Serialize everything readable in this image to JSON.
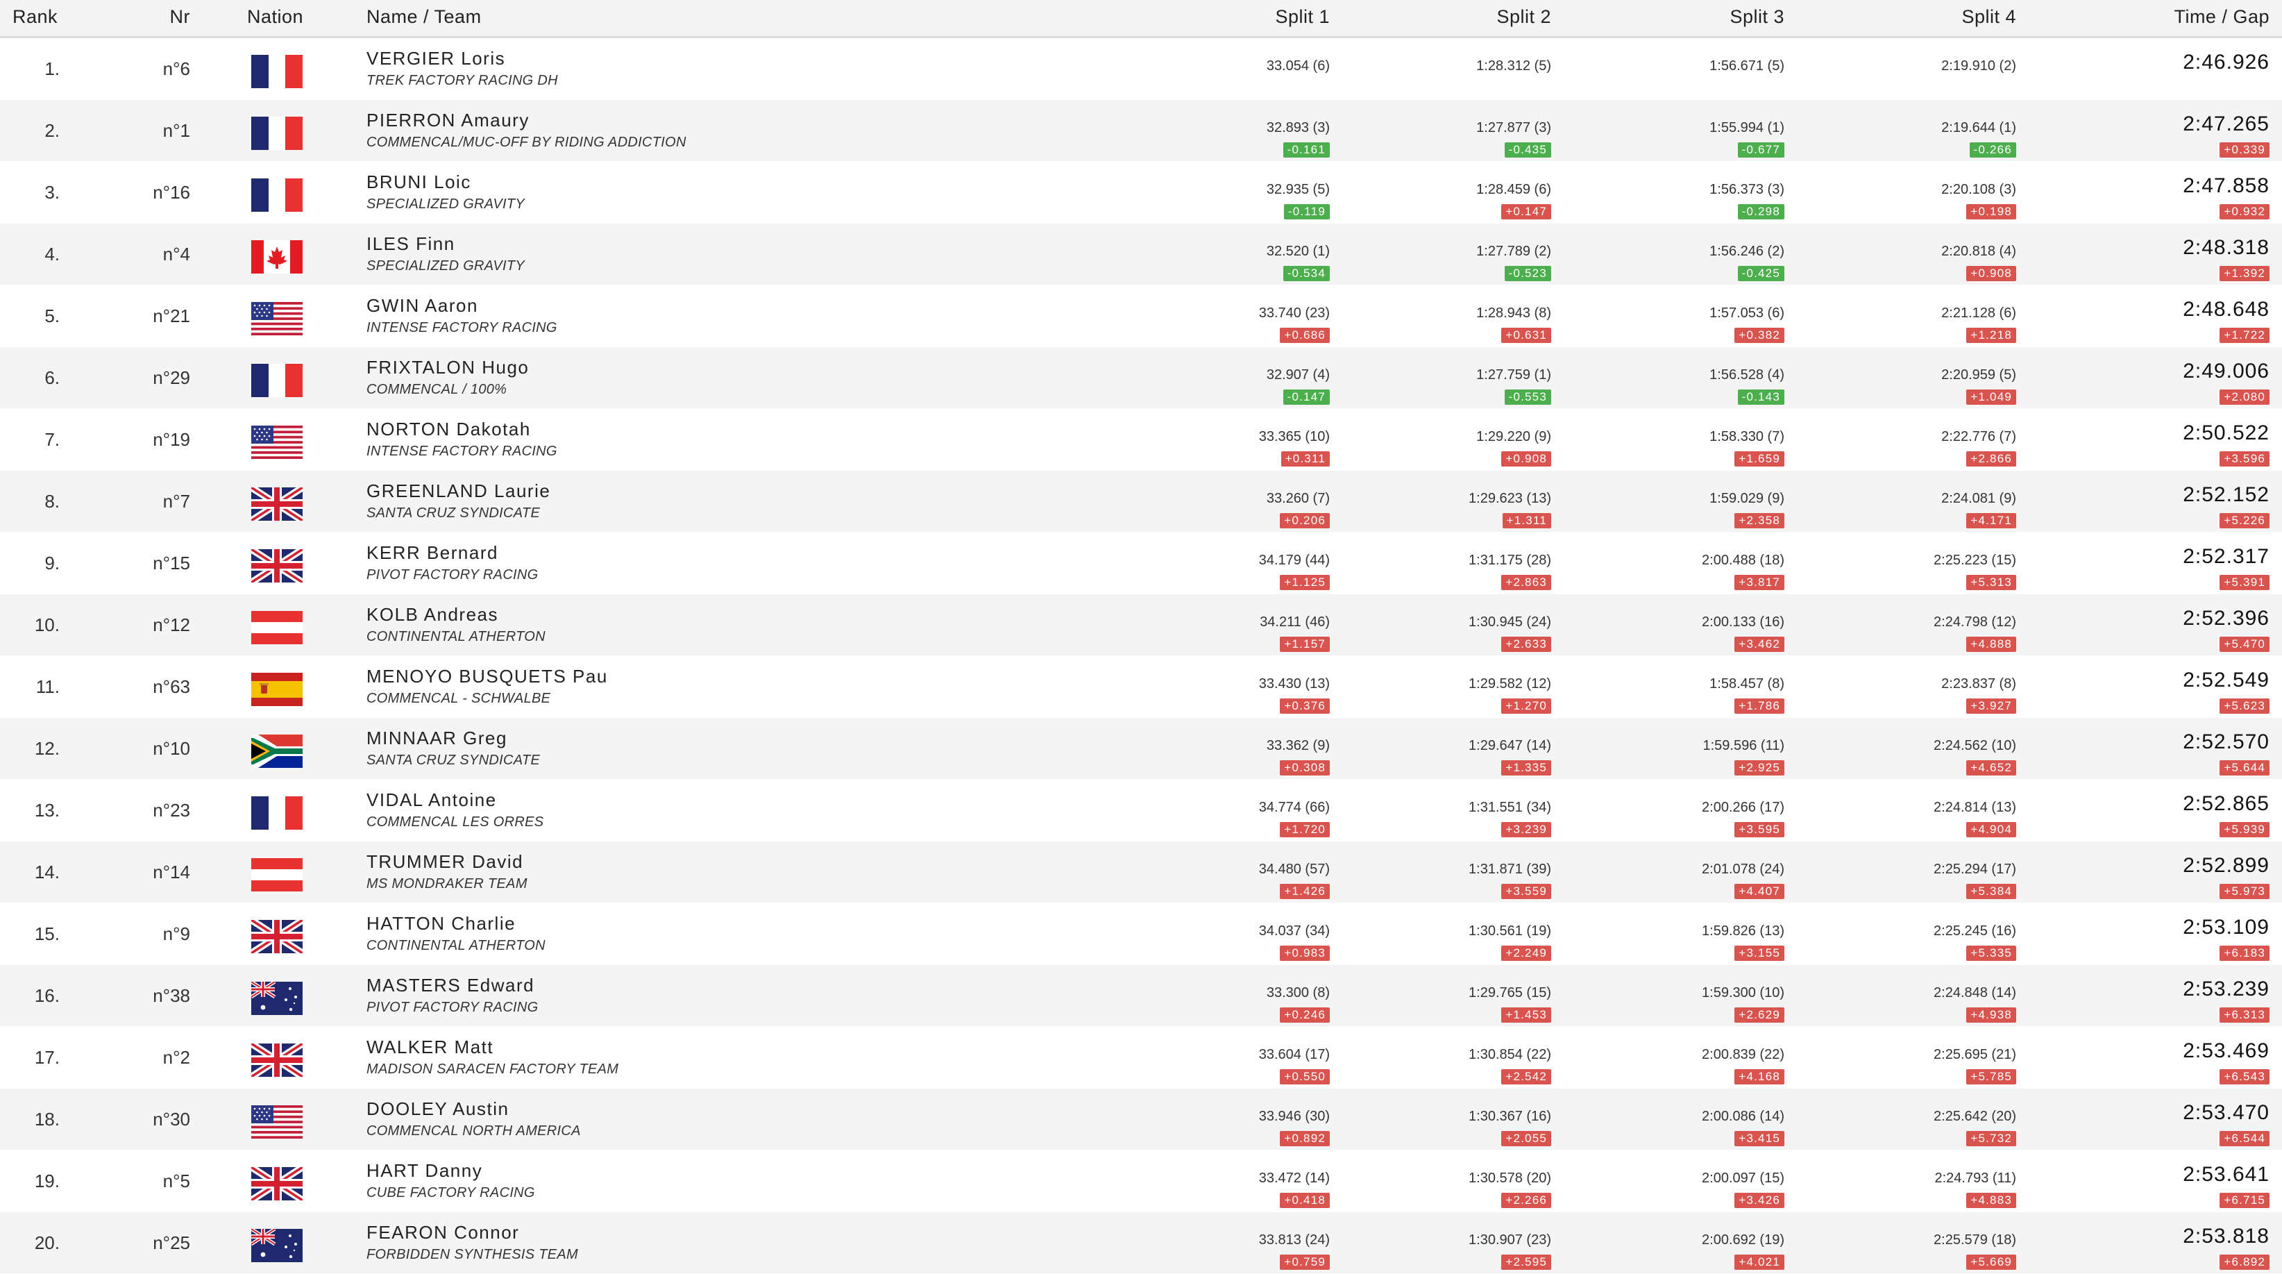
{
  "headers": {
    "rank": "Rank",
    "nr": "Nr",
    "nation": "Nation",
    "name_team": "Name / Team",
    "split1": "Split 1",
    "split2": "Split 2",
    "split3": "Split 3",
    "split4": "Split 4",
    "time_gap": "Time / Gap"
  },
  "colors": {
    "positive_badge": "#d9534f",
    "negative_badge": "#4cae4c",
    "alt_row": "#f4f4f4"
  },
  "rows": [
    {
      "rank": "1.",
      "nr": "n°6",
      "flag": "fr",
      "name": "VERGIER Loris",
      "team": "TREK FACTORY RACING DH",
      "s1": "33.054 (6)",
      "s1d": "",
      "s2": "1:28.312 (5)",
      "s2d": "",
      "s3": "1:56.671 (5)",
      "s3d": "",
      "s4": "2:19.910 (2)",
      "s4d": "",
      "time": "2:46.926",
      "gap": ""
    },
    {
      "rank": "2.",
      "nr": "n°1",
      "flag": "fr",
      "name": "PIERRON Amaury",
      "team": "COMMENCAL/MUC-OFF BY RIDING ADDICTION",
      "s1": "32.893 (3)",
      "s1d": "-0.161",
      "s2": "1:27.877 (3)",
      "s2d": "-0.435",
      "s3": "1:55.994 (1)",
      "s3d": "-0.677",
      "s4": "2:19.644 (1)",
      "s4d": "-0.266",
      "time": "2:47.265",
      "gap": "+0.339"
    },
    {
      "rank": "3.",
      "nr": "n°16",
      "flag": "fr",
      "name": "BRUNI Loic",
      "team": "SPECIALIZED GRAVITY",
      "s1": "32.935 (5)",
      "s1d": "-0.119",
      "s2": "1:28.459 (6)",
      "s2d": "+0.147",
      "s3": "1:56.373 (3)",
      "s3d": "-0.298",
      "s4": "2:20.108 (3)",
      "s4d": "+0.198",
      "time": "2:47.858",
      "gap": "+0.932"
    },
    {
      "rank": "4.",
      "nr": "n°4",
      "flag": "ca",
      "name": "ILES Finn",
      "team": "SPECIALIZED GRAVITY",
      "s1": "32.520 (1)",
      "s1d": "-0.534",
      "s2": "1:27.789 (2)",
      "s2d": "-0.523",
      "s3": "1:56.246 (2)",
      "s3d": "-0.425",
      "s4": "2:20.818 (4)",
      "s4d": "+0.908",
      "time": "2:48.318",
      "gap": "+1.392"
    },
    {
      "rank": "5.",
      "nr": "n°21",
      "flag": "us",
      "name": "GWIN Aaron",
      "team": "INTENSE FACTORY RACING",
      "s1": "33.740 (23)",
      "s1d": "+0.686",
      "s2": "1:28.943 (8)",
      "s2d": "+0.631",
      "s3": "1:57.053 (6)",
      "s3d": "+0.382",
      "s4": "2:21.128 (6)",
      "s4d": "+1.218",
      "time": "2:48.648",
      "gap": "+1.722"
    },
    {
      "rank": "6.",
      "nr": "n°29",
      "flag": "fr",
      "name": "FRIXTALON Hugo",
      "team": "COMMENCAL / 100%",
      "s1": "32.907 (4)",
      "s1d": "-0.147",
      "s2": "1:27.759 (1)",
      "s2d": "-0.553",
      "s3": "1:56.528 (4)",
      "s3d": "-0.143",
      "s4": "2:20.959 (5)",
      "s4d": "+1.049",
      "time": "2:49.006",
      "gap": "+2.080"
    },
    {
      "rank": "7.",
      "nr": "n°19",
      "flag": "us",
      "name": "NORTON Dakotah",
      "team": "INTENSE FACTORY RACING",
      "s1": "33.365 (10)",
      "s1d": "+0.311",
      "s2": "1:29.220 (9)",
      "s2d": "+0.908",
      "s3": "1:58.330 (7)",
      "s3d": "+1.659",
      "s4": "2:22.776 (7)",
      "s4d": "+2.866",
      "time": "2:50.522",
      "gap": "+3.596"
    },
    {
      "rank": "8.",
      "nr": "n°7",
      "flag": "gb",
      "name": "GREENLAND Laurie",
      "team": "SANTA CRUZ SYNDICATE",
      "s1": "33.260 (7)",
      "s1d": "+0.206",
      "s2": "1:29.623 (13)",
      "s2d": "+1.311",
      "s3": "1:59.029 (9)",
      "s3d": "+2.358",
      "s4": "2:24.081 (9)",
      "s4d": "+4.171",
      "time": "2:52.152",
      "gap": "+5.226"
    },
    {
      "rank": "9.",
      "nr": "n°15",
      "flag": "gb",
      "name": "KERR Bernard",
      "team": "PIVOT FACTORY RACING",
      "s1": "34.179 (44)",
      "s1d": "+1.125",
      "s2": "1:31.175 (28)",
      "s2d": "+2.863",
      "s3": "2:00.488 (18)",
      "s3d": "+3.817",
      "s4": "2:25.223 (15)",
      "s4d": "+5.313",
      "time": "2:52.317",
      "gap": "+5.391"
    },
    {
      "rank": "10.",
      "nr": "n°12",
      "flag": "at",
      "name": "KOLB Andreas",
      "team": "CONTINENTAL ATHERTON",
      "s1": "34.211 (46)",
      "s1d": "+1.157",
      "s2": "1:30.945 (24)",
      "s2d": "+2.633",
      "s3": "2:00.133 (16)",
      "s3d": "+3.462",
      "s4": "2:24.798 (12)",
      "s4d": "+4.888",
      "time": "2:52.396",
      "gap": "+5.470"
    },
    {
      "rank": "11.",
      "nr": "n°63",
      "flag": "es",
      "name": "MENOYO BUSQUETS Pau",
      "team": "COMMENCAL - SCHWALBE",
      "s1": "33.430 (13)",
      "s1d": "+0.376",
      "s2": "1:29.582 (12)",
      "s2d": "+1.270",
      "s3": "1:58.457 (8)",
      "s3d": "+1.786",
      "s4": "2:23.837 (8)",
      "s4d": "+3.927",
      "time": "2:52.549",
      "gap": "+5.623"
    },
    {
      "rank": "12.",
      "nr": "n°10",
      "flag": "za",
      "name": "MINNAAR Greg",
      "team": "SANTA CRUZ SYNDICATE",
      "s1": "33.362 (9)",
      "s1d": "+0.308",
      "s2": "1:29.647 (14)",
      "s2d": "+1.335",
      "s3": "1:59.596 (11)",
      "s3d": "+2.925",
      "s4": "2:24.562 (10)",
      "s4d": "+4.652",
      "time": "2:52.570",
      "gap": "+5.644"
    },
    {
      "rank": "13.",
      "nr": "n°23",
      "flag": "fr",
      "name": "VIDAL Antoine",
      "team": "COMMENCAL LES ORRES",
      "s1": "34.774 (66)",
      "s1d": "+1.720",
      "s2": "1:31.551 (34)",
      "s2d": "+3.239",
      "s3": "2:00.266 (17)",
      "s3d": "+3.595",
      "s4": "2:24.814 (13)",
      "s4d": "+4.904",
      "time": "2:52.865",
      "gap": "+5.939"
    },
    {
      "rank": "14.",
      "nr": "n°14",
      "flag": "at",
      "name": "TRUMMER David",
      "team": "MS MONDRAKER TEAM",
      "s1": "34.480 (57)",
      "s1d": "+1.426",
      "s2": "1:31.871 (39)",
      "s2d": "+3.559",
      "s3": "2:01.078 (24)",
      "s3d": "+4.407",
      "s4": "2:25.294 (17)",
      "s4d": "+5.384",
      "time": "2:52.899",
      "gap": "+5.973"
    },
    {
      "rank": "15.",
      "nr": "n°9",
      "flag": "gb",
      "name": "HATTON Charlie",
      "team": "CONTINENTAL ATHERTON",
      "s1": "34.037 (34)",
      "s1d": "+0.983",
      "s2": "1:30.561 (19)",
      "s2d": "+2.249",
      "s3": "1:59.826 (13)",
      "s3d": "+3.155",
      "s4": "2:25.245 (16)",
      "s4d": "+5.335",
      "time": "2:53.109",
      "gap": "+6.183"
    },
    {
      "rank": "16.",
      "nr": "n°38",
      "flag": "au",
      "name": "MASTERS Edward",
      "team": "PIVOT FACTORY RACING",
      "s1": "33.300 (8)",
      "s1d": "+0.246",
      "s2": "1:29.765 (15)",
      "s2d": "+1.453",
      "s3": "1:59.300 (10)",
      "s3d": "+2.629",
      "s4": "2:24.848 (14)",
      "s4d": "+4.938",
      "time": "2:53.239",
      "gap": "+6.313"
    },
    {
      "rank": "17.",
      "nr": "n°2",
      "flag": "gb",
      "name": "WALKER Matt",
      "team": "MADISON SARACEN FACTORY TEAM",
      "s1": "33.604 (17)",
      "s1d": "+0.550",
      "s2": "1:30.854 (22)",
      "s2d": "+2.542",
      "s3": "2:00.839 (22)",
      "s3d": "+4.168",
      "s4": "2:25.695 (21)",
      "s4d": "+5.785",
      "time": "2:53.469",
      "gap": "+6.543"
    },
    {
      "rank": "18.",
      "nr": "n°30",
      "flag": "us",
      "name": "DOOLEY Austin",
      "team": "COMMENCAL NORTH AMERICA",
      "s1": "33.946 (30)",
      "s1d": "+0.892",
      "s2": "1:30.367 (16)",
      "s2d": "+2.055",
      "s3": "2:00.086 (14)",
      "s3d": "+3.415",
      "s4": "2:25.642 (20)",
      "s4d": "+5.732",
      "time": "2:53.470",
      "gap": "+6.544"
    },
    {
      "rank": "19.",
      "nr": "n°5",
      "flag": "gb",
      "name": "HART Danny",
      "team": "CUBE FACTORY RACING",
      "s1": "33.472 (14)",
      "s1d": "+0.418",
      "s2": "1:30.578 (20)",
      "s2d": "+2.266",
      "s3": "2:00.097 (15)",
      "s3d": "+3.426",
      "s4": "2:24.793 (11)",
      "s4d": "+4.883",
      "time": "2:53.641",
      "gap": "+6.715"
    },
    {
      "rank": "20.",
      "nr": "n°25",
      "flag": "au",
      "name": "FEARON Connor",
      "team": "FORBIDDEN SYNTHESIS TEAM",
      "s1": "33.813 (24)",
      "s1d": "+0.759",
      "s2": "1:30.907 (23)",
      "s2d": "+2.595",
      "s3": "2:00.692 (19)",
      "s3d": "+4.021",
      "s4": "2:25.579 (18)",
      "s4d": "+5.669",
      "time": "2:53.818",
      "gap": "+6.892"
    }
  ]
}
